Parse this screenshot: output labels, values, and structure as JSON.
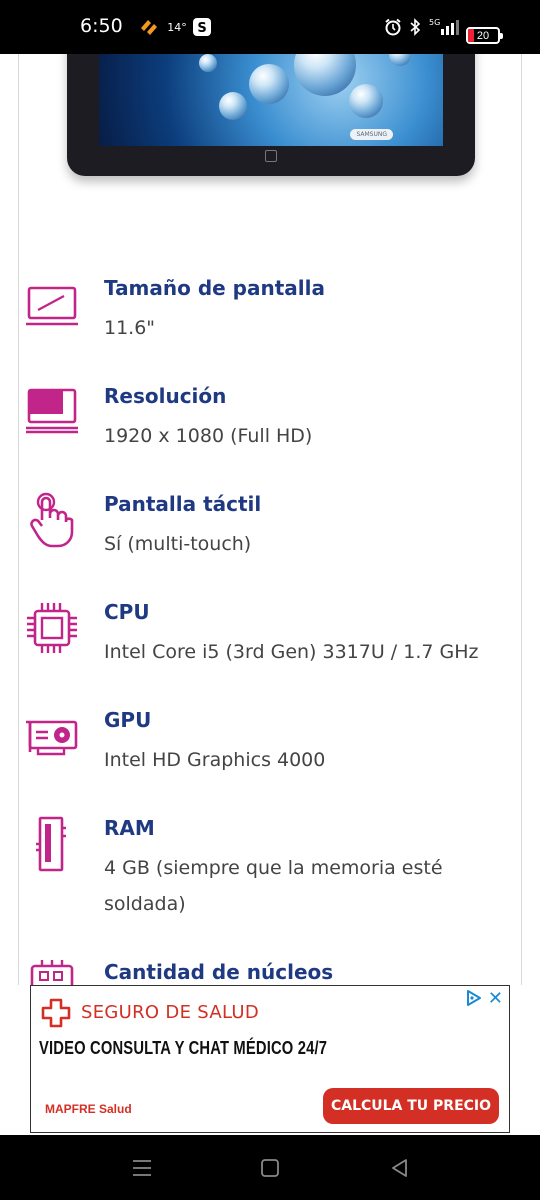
{
  "status_bar": {
    "time": "6:50",
    "temperature": "14°",
    "battery": "20",
    "network": "5G",
    "icons": [
      "app-notification-icon",
      "s-app-icon",
      "alarm-icon",
      "bluetooth-icon",
      "signal-icon",
      "battery-icon"
    ]
  },
  "product_image": {
    "brand": "SAMSUNG"
  },
  "specs": [
    {
      "icon": "screen-size-icon",
      "title": "Tamaño de pantalla",
      "value": "11.6\""
    },
    {
      "icon": "resolution-icon",
      "title": "Resolución",
      "value": "1920 x 1080 (Full HD)"
    },
    {
      "icon": "touch-hand-icon",
      "title": "Pantalla táctil",
      "value": "Sí (multi-touch)"
    },
    {
      "icon": "cpu-chip-icon",
      "title": "CPU",
      "value": "Intel Core i5 (3rd Gen) 3317U / 1.7 GHz"
    },
    {
      "icon": "gpu-card-icon",
      "title": "GPU",
      "value": "Intel HD Graphics 4000"
    },
    {
      "icon": "ram-module-icon",
      "title": "RAM",
      "value": "4 GB (siempre que la memoria esté soldada)"
    },
    {
      "icon": "cores-chip-icon",
      "title": "Cantidad de núcleos",
      "value": ""
    }
  ],
  "ad": {
    "headline": "SEGURO DE SALUD",
    "subline": "VIDEO CONSULTA Y CHAT MÉDICO 24/7",
    "brand": "MAPFRE Salud",
    "cta": "CALCULA TU PRECIO",
    "close": "✕"
  },
  "colors": {
    "accent_magenta": "#c2258a",
    "title_blue": "#1f3a82",
    "ad_red": "#d32f24"
  }
}
